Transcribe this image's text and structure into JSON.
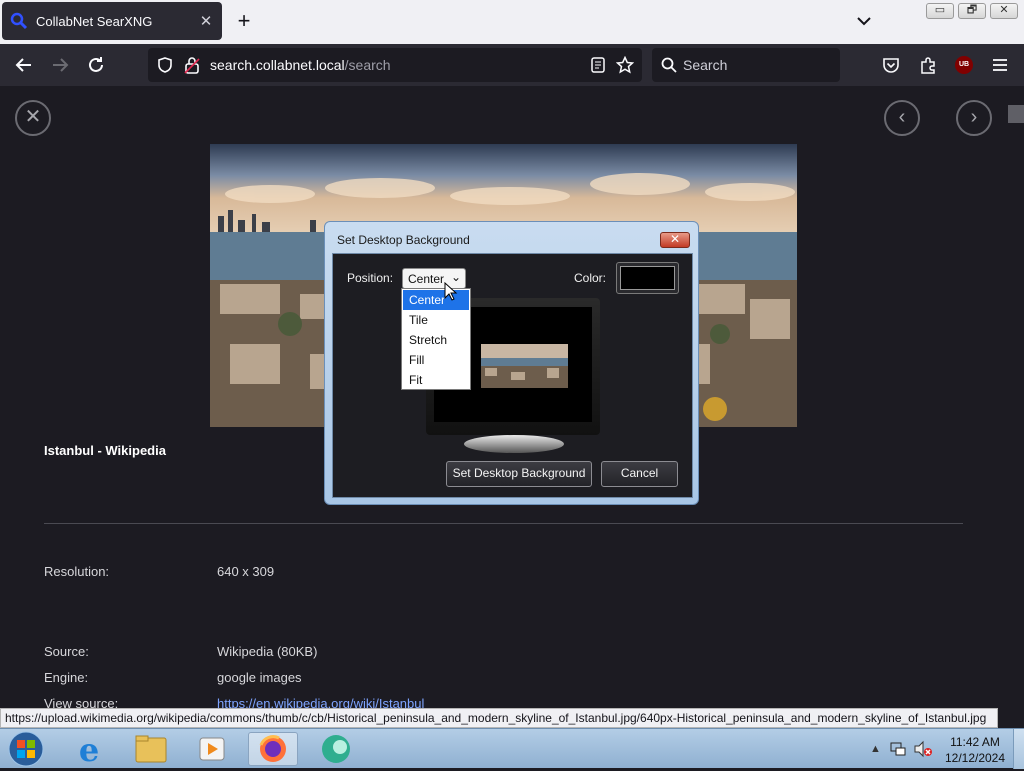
{
  "browser": {
    "tab_title": "CollabNet SearXNG",
    "tab_close": "✕",
    "new_tab": "+",
    "url_host": "search.collabnet.local",
    "url_path": "/search",
    "search_placeholder": "Search",
    "ublock_label": "UB"
  },
  "window_controls": {
    "minimize": "▭",
    "restore": "🗗",
    "close": "✕"
  },
  "page": {
    "result_title": "Istanbul - Wikipedia",
    "details": [
      {
        "label": "Resolution:",
        "value": "640 x 309"
      },
      {
        "label": "Source:",
        "value": "Wikipedia (80KB)"
      },
      {
        "label": "Engine:",
        "value": "google images"
      },
      {
        "label": "View source:",
        "value": "https://en.wikipedia.org/wiki/Istanbul"
      }
    ]
  },
  "status_url": "https://upload.wikimedia.org/wikipedia/commons/thumb/c/cb/Historical_peninsula_and_modern_skyline_of_Istanbul.jpg/640px-Historical_peninsula_and_modern_skyline_of_Istanbul.jpg",
  "dialog": {
    "title": "Set Desktop Background",
    "close": "✕",
    "position_label": "Position:",
    "position_value": "Center",
    "color_label": "Color:",
    "color_value": "#000000",
    "options": [
      "Center",
      "Tile",
      "Stretch",
      "Fill",
      "Fit"
    ],
    "selected_option": "Center",
    "set_button": "Set Desktop Background",
    "cancel_button": "Cancel"
  },
  "taskbar": {
    "time": "11:42 AM",
    "date": "12/12/2024",
    "pinned": [
      "internet-explorer",
      "file-explorer",
      "media-player",
      "firefox",
      "app"
    ]
  },
  "colors": {
    "accent": "#1e73e8",
    "link": "#7ea4ff",
    "page_bg": "#1c1b22"
  }
}
